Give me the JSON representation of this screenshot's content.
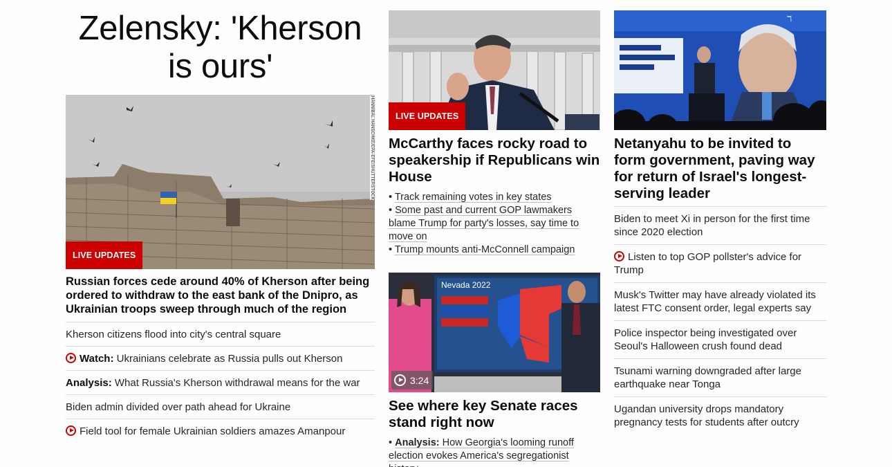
{
  "col1": {
    "headline": "Zelensky: 'Kherson is ours'",
    "image_credit": "HANNIBAL HANSCHKE/EPA-EFE/SHUTTERSTOCK",
    "live_label": "LIVE UPDATES",
    "lead": "Russian forces cede around 40% of Kherson after being ordered to withdraw to the east bank of the Dnipro, as Ukrainian troops sweep through much of the region",
    "links": [
      {
        "prefix": "",
        "text": "Kherson citizens flood into city's central square",
        "video": false
      },
      {
        "prefix": "Watch:",
        "text": " Ukrainians celebrate as Russia pulls out Kherson",
        "video": true
      },
      {
        "prefix": "Analysis:",
        "text": " What Russia's Kherson withdrawal means for the war",
        "video": false
      },
      {
        "prefix": "",
        "text": "Biden admin divided over path ahead for Ukraine",
        "video": false
      },
      {
        "prefix": "",
        "text": "Field tool for female Ukrainian soldiers amazes Amanpour",
        "video": true
      }
    ]
  },
  "col2": {
    "story1": {
      "live_label": "LIVE UPDATES",
      "headline": "McCarthy faces rocky road to speakership if Republicans win House",
      "bullets": [
        "Track remaining votes in key states",
        "Some past and current GOP lawmakers blame Trump for party's losses, say time to move on",
        "Trump mounts anti-McConnell campaign"
      ]
    },
    "story2": {
      "video_duration": "3:24",
      "screen_title": "Nevada 2022",
      "headline": "See where key Senate races stand right now",
      "bullet_prefix": "Analysis:",
      "bullet_text": " How Georgia's looming runoff election evokes America's segregationist history"
    }
  },
  "col3": {
    "headline": "Netanyahu to be invited to form government, paving way for return of Israel's longest-serving leader",
    "links": [
      {
        "text": "Biden to meet Xi in person for the first time since 2020 election",
        "video": false
      },
      {
        "text": "Listen to top GOP pollster's advice for Trump",
        "video": true
      },
      {
        "text": "Musk's Twitter may have already violated its latest FTC consent order, legal experts say",
        "video": false
      },
      {
        "text": "Police inspector being investigated over Seoul's Halloween crush found dead",
        "video": false
      },
      {
        "text": "Tsunami warning downgraded after large earthquake near Tonga",
        "video": false
      },
      {
        "text": "Ugandan university drops mandatory pregnancy tests for students after outcry",
        "video": false
      }
    ]
  },
  "colors": {
    "accent": "#cc0000",
    "text": "#0c0c0c",
    "divider": "#dcdcdc"
  }
}
